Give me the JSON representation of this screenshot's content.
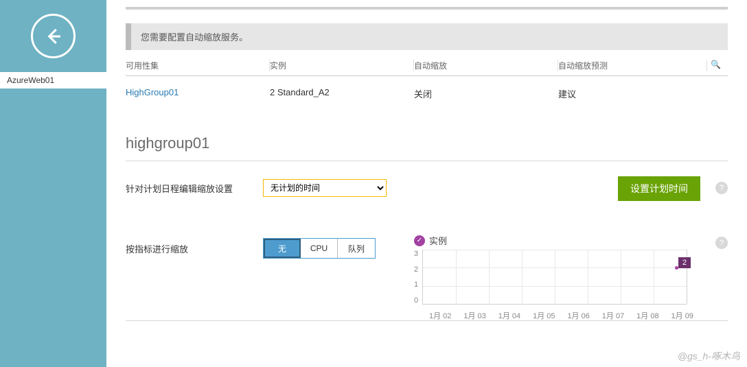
{
  "sidebar": {
    "active_item": "AzureWeb01"
  },
  "notice": "您需要配置自动缩放服务。",
  "table": {
    "headers": [
      "可用性集",
      "实例",
      "自动缩放",
      "自动缩放预测"
    ],
    "row": {
      "availability_set": "HighGroup01",
      "instances": "2 Standard_A2",
      "autoscale": "关闭",
      "prediction": "建议"
    }
  },
  "group_title": "highgroup01",
  "schedule": {
    "label": "针对计划日程编辑缩放设置",
    "selected": "无计划的时间",
    "button": "设置计划时间"
  },
  "scale_by": {
    "label": "按指标进行缩放",
    "options": [
      "无",
      "CPU",
      "队列"
    ],
    "active": "无"
  },
  "chart_data": {
    "type": "line",
    "title": "实例",
    "ylabel": "",
    "ylim": [
      0,
      3
    ],
    "yticks": [
      0,
      1,
      2,
      3
    ],
    "categories": [
      "1月 02",
      "1月 03",
      "1月 04",
      "1月 05",
      "1月 06",
      "1月 07",
      "1月 08",
      "1月 09"
    ],
    "series": [
      {
        "name": "实例",
        "values": [
          null,
          null,
          null,
          null,
          null,
          null,
          null,
          2
        ]
      }
    ],
    "point_label": "2"
  },
  "watermark": "@gs_h-啄木鸟",
  "icons": {
    "search": "🔍",
    "help": "?",
    "check": "✓"
  }
}
